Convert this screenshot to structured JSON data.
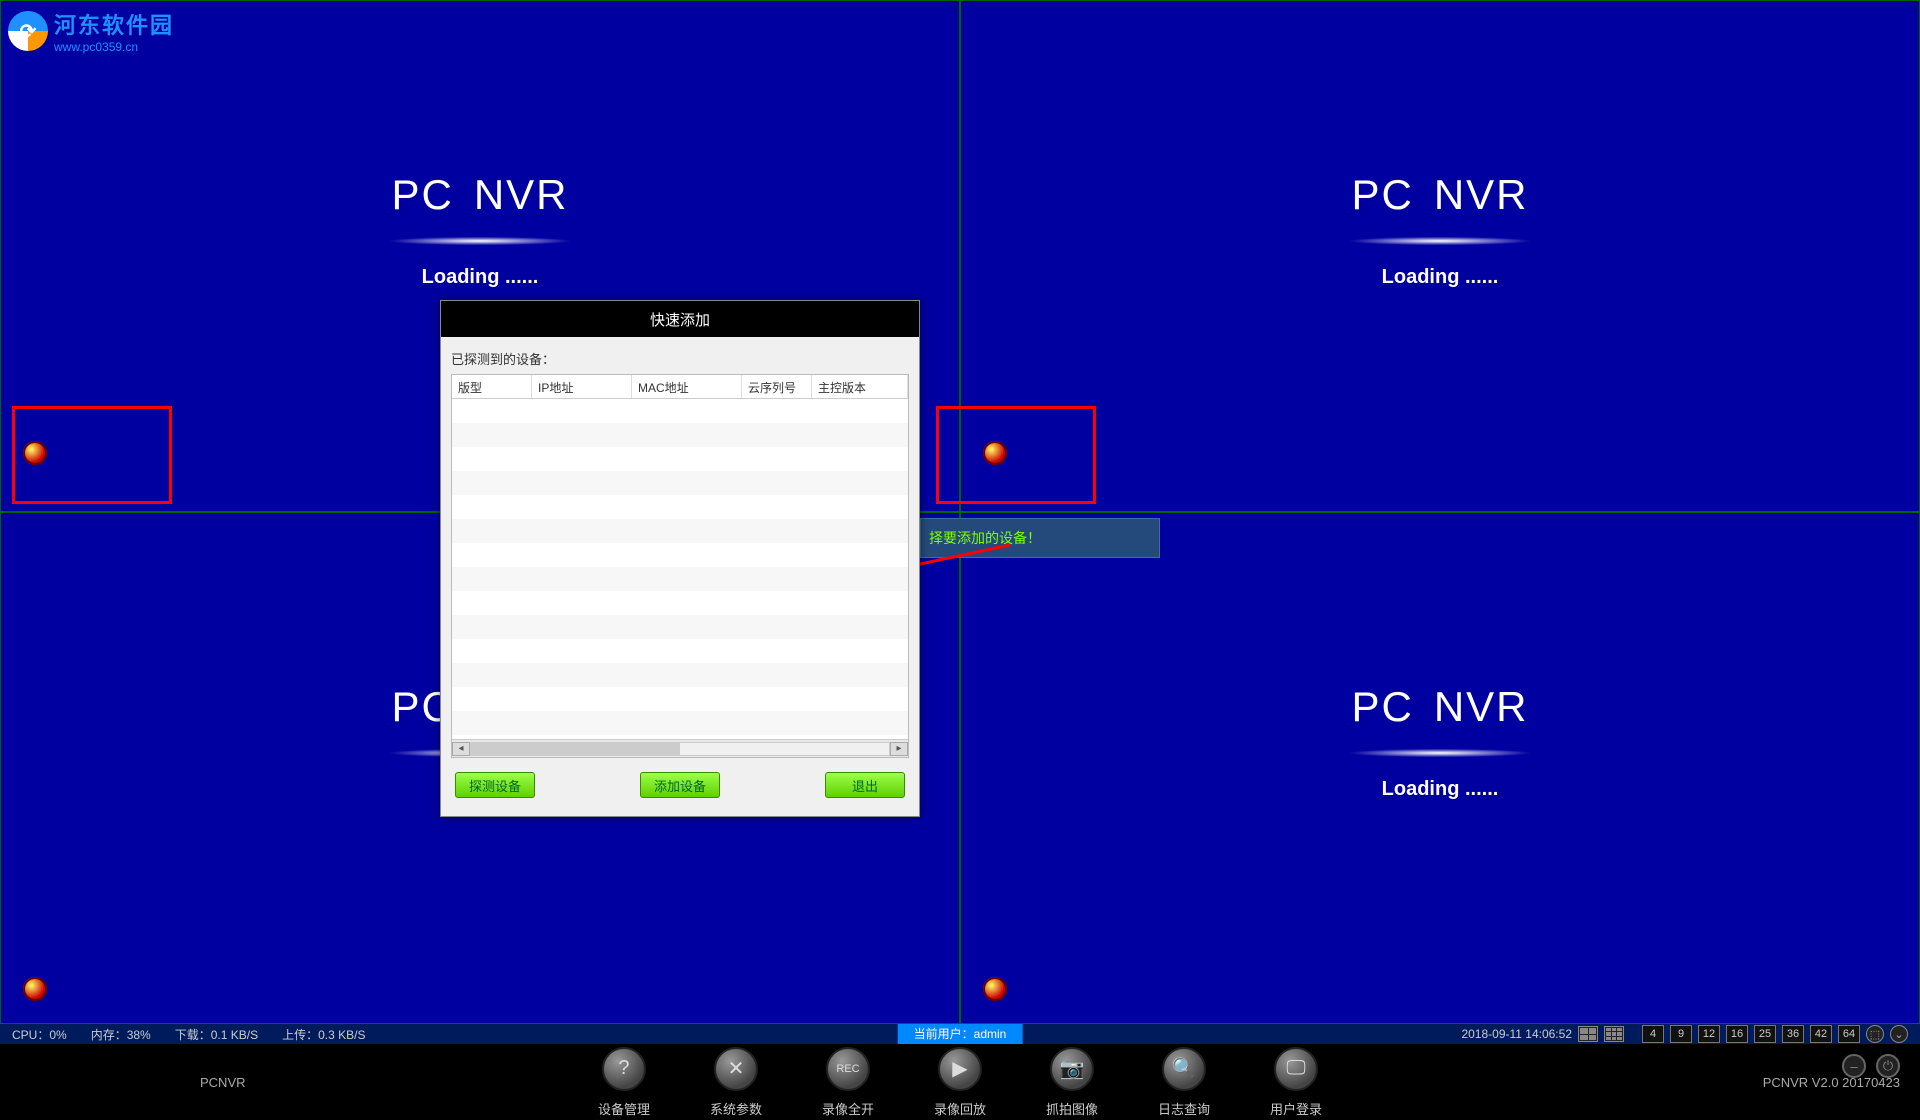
{
  "watermark": {
    "cn": "河东软件园",
    "url": "www.pc0359.cn"
  },
  "cell": {
    "title_pc": "PC",
    "title_nvr": "NVR",
    "loading": "Loading ......"
  },
  "tooltip": "择要添加的设备！",
  "dialog": {
    "title": "快速添加",
    "probed": "已探测到的设备：",
    "columns": {
      "c1": "版型",
      "c2": "IP地址",
      "c3": "MAC地址",
      "c4": "云序列号",
      "c5": "主控版本"
    },
    "buttons": {
      "detect": "探测设备",
      "add": "添加设备",
      "exit": "退出"
    }
  },
  "status": {
    "cpu": "CPU：0%",
    "mem": "内存：38%",
    "down": "下载：0.1 KB/S",
    "up": "上传：0.3 KB/S",
    "user_label": "当前用户：",
    "user_name": "admin",
    "datetime": "2018-09-11 14:06:52",
    "layouts": [
      "4",
      "9",
      "12",
      "16",
      "25",
      "36",
      "42",
      "64"
    ]
  },
  "toolbar": {
    "appname": "PCNVR",
    "version": "PCNVR  V2.0  20170423",
    "items": [
      {
        "icon": "?",
        "label": "设备管理"
      },
      {
        "icon": "✕",
        "label": "系统参数"
      },
      {
        "icon": "REC",
        "label": "录像全开"
      },
      {
        "icon": "▶",
        "label": "录像回放"
      },
      {
        "icon": "📷",
        "label": "抓拍图像"
      },
      {
        "icon": "🔍",
        "label": "日志查询"
      },
      {
        "icon": "🖵",
        "label": "用户登录"
      }
    ]
  }
}
